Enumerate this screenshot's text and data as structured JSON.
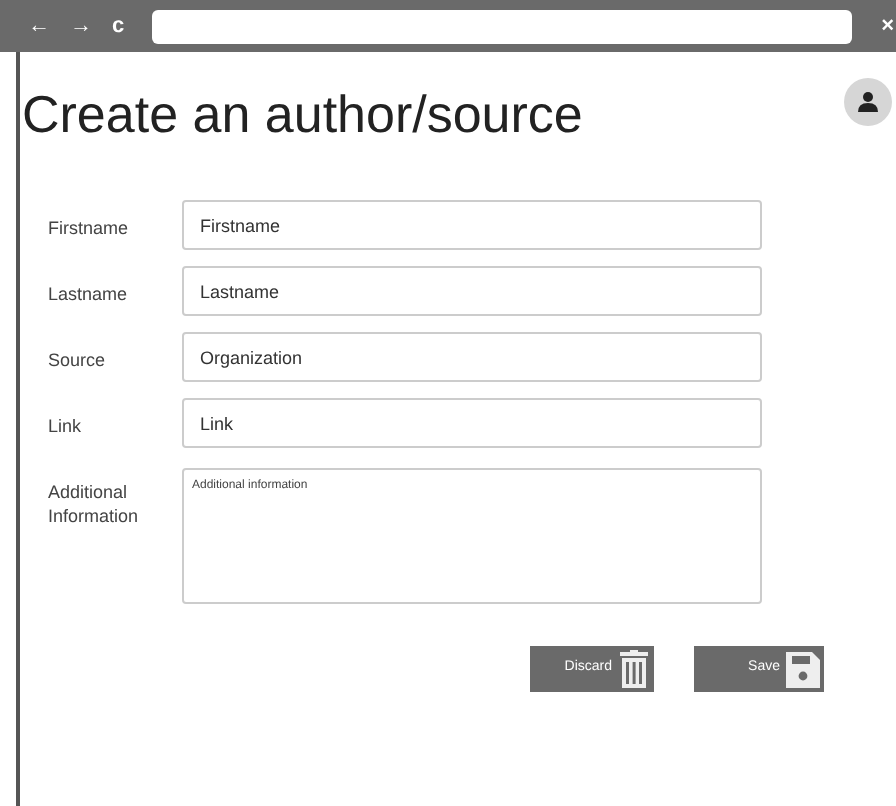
{
  "browser": {
    "back": "←",
    "forward": "→",
    "reload": "c",
    "close": "×"
  },
  "title": "Create an author/source",
  "fields": [
    {
      "label": "Firstname",
      "placeholder": "Firstname",
      "kind": "input"
    },
    {
      "label": "Lastname",
      "placeholder": "Lastname",
      "kind": "input"
    },
    {
      "label": "Source",
      "placeholder": "Organization",
      "kind": "input"
    },
    {
      "label": "Link",
      "placeholder": "Link",
      "kind": "input"
    },
    {
      "label": "Additional Information",
      "placeholder": "Additional information",
      "kind": "textarea"
    }
  ],
  "buttons": [
    {
      "label": "Discard",
      "kind": "discard"
    },
    {
      "label": "Save",
      "kind": "save"
    }
  ]
}
